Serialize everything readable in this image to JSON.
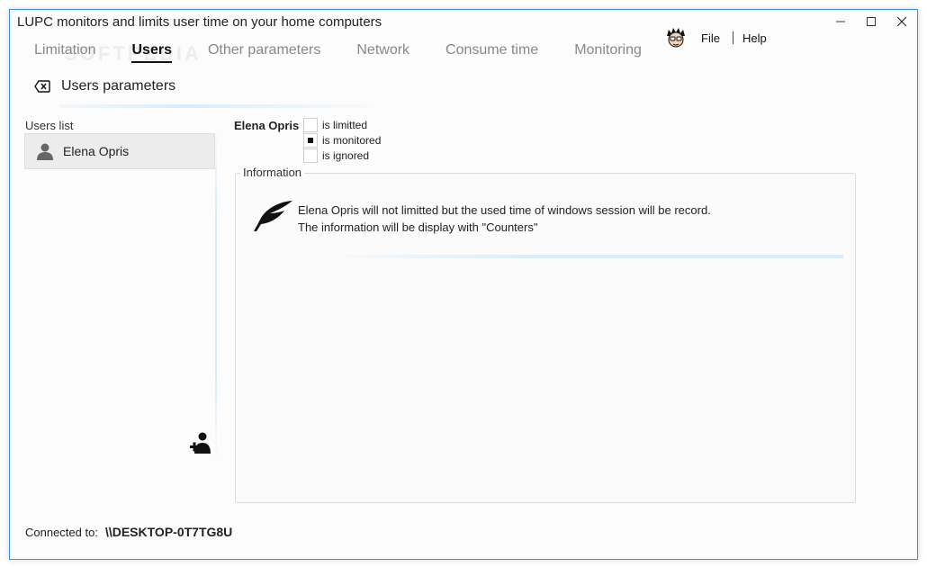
{
  "window": {
    "title": "LUPC monitors and limits user time on your home computers"
  },
  "menu": {
    "items": [
      {
        "label": "File"
      },
      {
        "label": "Help"
      }
    ]
  },
  "tabs": [
    {
      "label": "Limitation",
      "active": false
    },
    {
      "label": "Users",
      "active": true
    },
    {
      "label": "Other parameters",
      "active": false
    },
    {
      "label": "Network",
      "active": false
    },
    {
      "label": "Consume time",
      "active": false
    },
    {
      "label": "Monitoring",
      "active": false
    }
  ],
  "section": {
    "title": "Users parameters"
  },
  "users_list": {
    "label": "Users list",
    "items": [
      {
        "name": "Elena Opris"
      }
    ]
  },
  "selected_user": {
    "name": "Elena Opris",
    "options": [
      {
        "label": "is limitted",
        "checked": false
      },
      {
        "label": "is monitored",
        "checked": true
      },
      {
        "label": "is ignored",
        "checked": false
      }
    ]
  },
  "information": {
    "legend": "Information",
    "line1": "Elena Opris will not limitted but the used time of windows session will be record.",
    "line2": "The information will be display with \"Counters\""
  },
  "status": {
    "label": "Connected to:",
    "value": "\\\\DESKTOP-0T7TG8U"
  },
  "colors": {
    "window_border": "#3a8ee6",
    "accent_line": "#d9ecfa"
  }
}
